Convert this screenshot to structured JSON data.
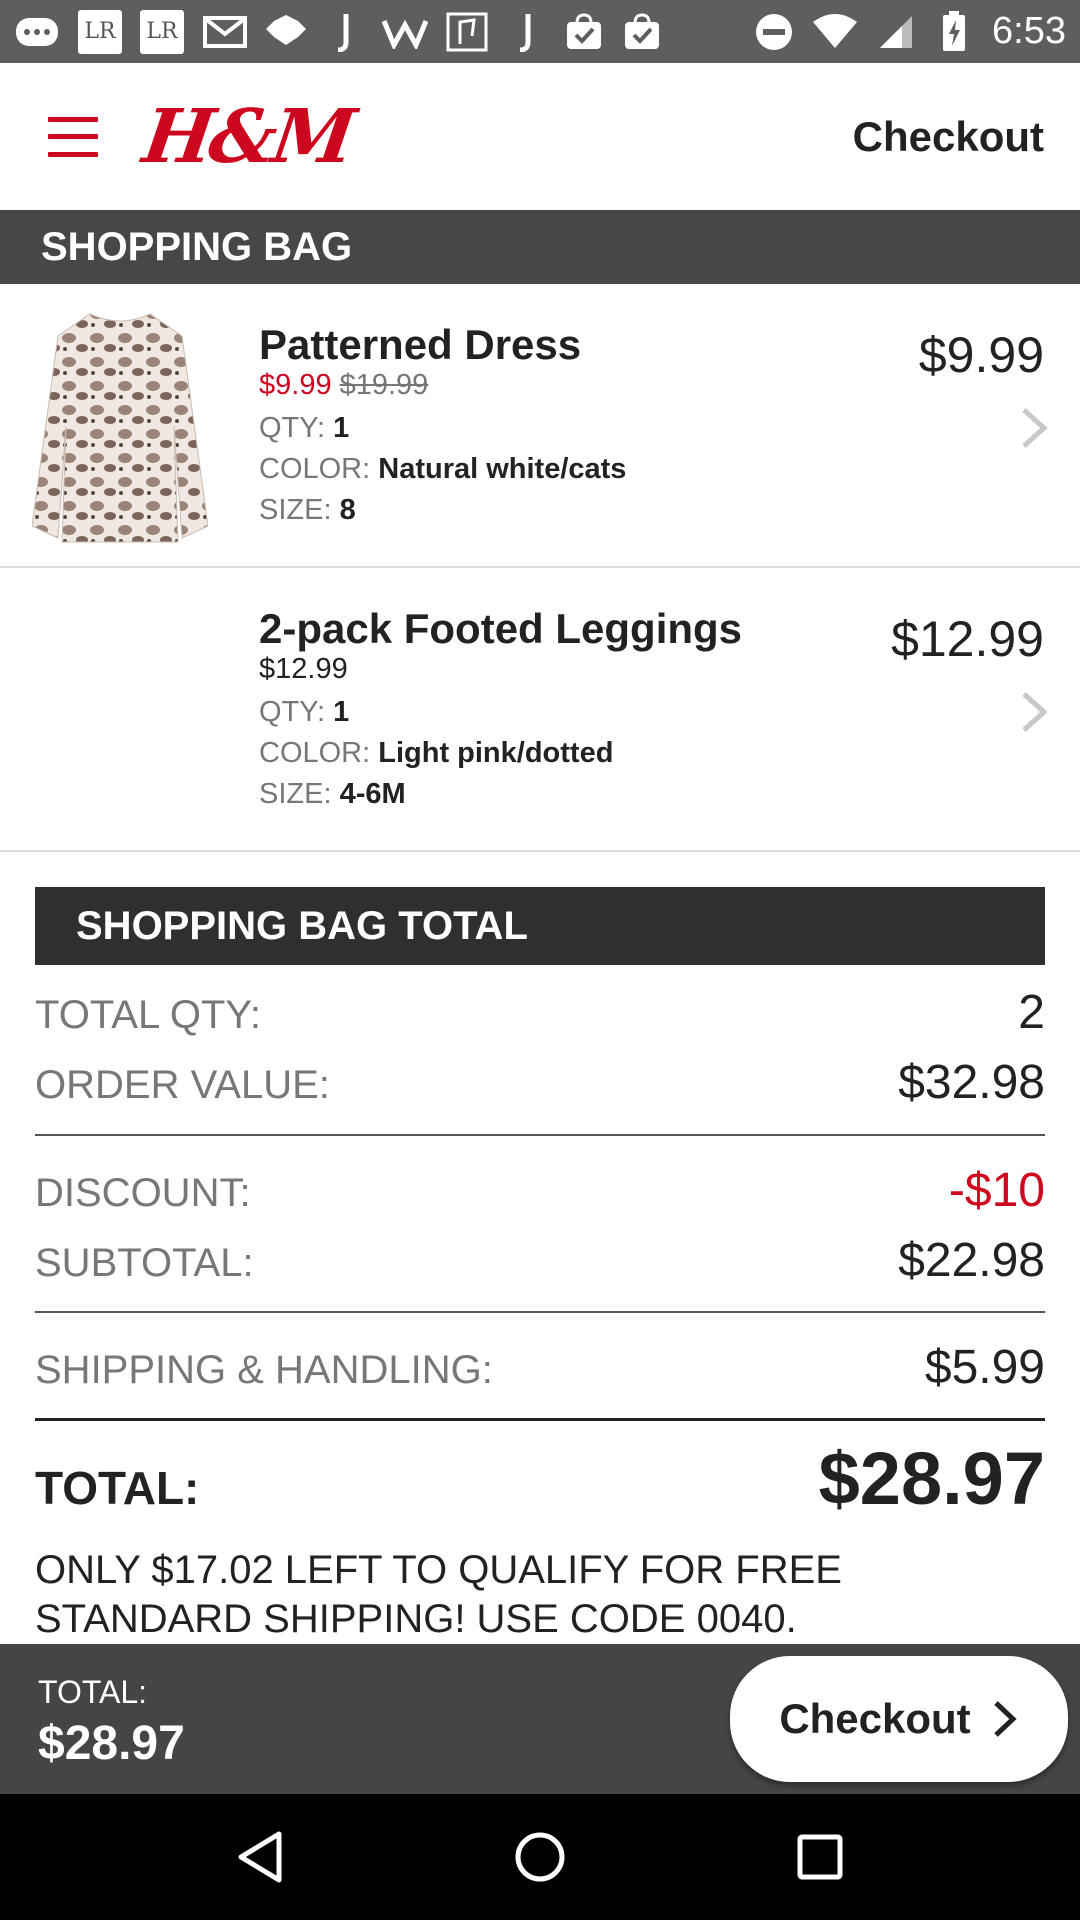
{
  "status_bar": {
    "time": "6:53",
    "icons": [
      "chat-bubble-icon",
      "lr-icon",
      "lr-icon",
      "gmail-icon",
      "dropbox-icon",
      "j-icon",
      "w-icon",
      "map-icon",
      "j-icon",
      "shopping-bag-check-icon",
      "shopping-bag-check-icon"
    ],
    "right_icons": [
      "do-not-disturb-icon",
      "wifi-icon",
      "signal-icon",
      "battery-charging-icon"
    ],
    "lr_label": "LR"
  },
  "header": {
    "logo": "H&M",
    "title": "Checkout",
    "brand_color": "#cc071e"
  },
  "section": {
    "title": "SHOPPING BAG"
  },
  "items": [
    {
      "name": "Patterned Dress",
      "price_sale": "$9.99",
      "price_original": "$19.99",
      "qty_label": "QTY:",
      "qty": "1",
      "color_label": "COLOR:",
      "color": "Natural white/cats",
      "size_label": "SIZE:",
      "size": "8",
      "line_price": "$9.99"
    },
    {
      "name": "2-pack Footed Leggings",
      "price": "$12.99",
      "qty_label": "QTY:",
      "qty": "1",
      "color_label": "COLOR:",
      "color": "Light pink/dotted",
      "size_label": "SIZE:",
      "size": "4-6M",
      "line_price": "$12.99"
    }
  ],
  "totals": {
    "title": "SHOPPING BAG TOTAL",
    "total_qty_label": "TOTAL QTY:",
    "total_qty": "2",
    "order_value_label": "ORDER VALUE:",
    "order_value": "$32.98",
    "discount_label": "DISCOUNT:",
    "discount": "-$10",
    "subtotal_label": "SUBTOTAL:",
    "subtotal": "$22.98",
    "shipping_label": "SHIPPING & HANDLING:",
    "shipping": "$5.99",
    "total_label": "TOTAL:",
    "total": "$28.97",
    "promo": "ONLY $17.02 LEFT TO QUALIFY FOR FREE STANDARD SHIPPING! USE CODE 0040."
  },
  "bottom_bar": {
    "total_label": "TOTAL:",
    "total": "$28.97",
    "checkout_label": "Checkout"
  }
}
